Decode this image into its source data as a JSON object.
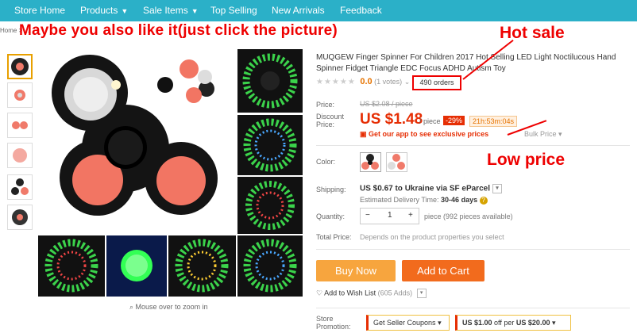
{
  "nav": {
    "items": [
      {
        "label": "Store Home",
        "caret": false
      },
      {
        "label": "Products",
        "caret": true
      },
      {
        "label": "Sale Items",
        "caret": true
      },
      {
        "label": "Top Selling",
        "caret": false
      },
      {
        "label": "New Arrivals",
        "caret": false
      },
      {
        "label": "Feedback",
        "caret": false
      }
    ],
    "bg": "#2bb0c8"
  },
  "breadcrumb": "Home > ...",
  "overlay": {
    "headline": "Maybe you also like it(just click the picture)",
    "hot_sale": "Hot sale",
    "low_price": "Low price"
  },
  "gallery": {
    "zoom_hint": "Mouse over to zoom in",
    "zoom_icon": "magnifier-icon"
  },
  "product": {
    "title": "MUQGEW Finger Spinner For Children 2017 Hot Selling LED Light Noctilucous Hand Spinner Fidget Triangle EDC Focus ADHD Autism Toy",
    "score": "0.0",
    "votes": "(1 votes)",
    "orders": "490 orders"
  },
  "pricing": {
    "price_label": "Price:",
    "old_price": "US $2.08 / piece",
    "discount_label": "Discount Price:",
    "price": "US $1.48",
    "per": "/ piece",
    "discount": "-29%",
    "timer": "21h:53m:04s",
    "app_promo": "Get our app to see exclusive prices",
    "bulk": "Bulk Price"
  },
  "options": {
    "color_label": "Color:",
    "shipping_label": "Shipping:",
    "shipping": "US $0.67 to Ukraine via SF eParcel",
    "estimated_prefix": "Estimated Delivery Time:",
    "estimated_value": "30-46 days",
    "quantity_label": "Quantity:",
    "quantity": "1",
    "available": "piece (992 pieces available)",
    "total_label": "Total Price:",
    "total": "Depends on the product properties you select"
  },
  "actions": {
    "buy": "Buy Now",
    "cart": "Add to Cart",
    "wishlist": "Add to Wish List",
    "wish_count": "(605 Adds)"
  },
  "promotion": {
    "label": "Store Promotion:",
    "coupons": "Get Seller Coupons",
    "offer_amount": "US $1.00",
    "offer_mid": "off per",
    "offer_min": "US $20.00"
  },
  "colors": {
    "accent": "#e62e04",
    "orange": "#f08a24",
    "buy": "#f7a53e",
    "annotation": "#e00000"
  }
}
